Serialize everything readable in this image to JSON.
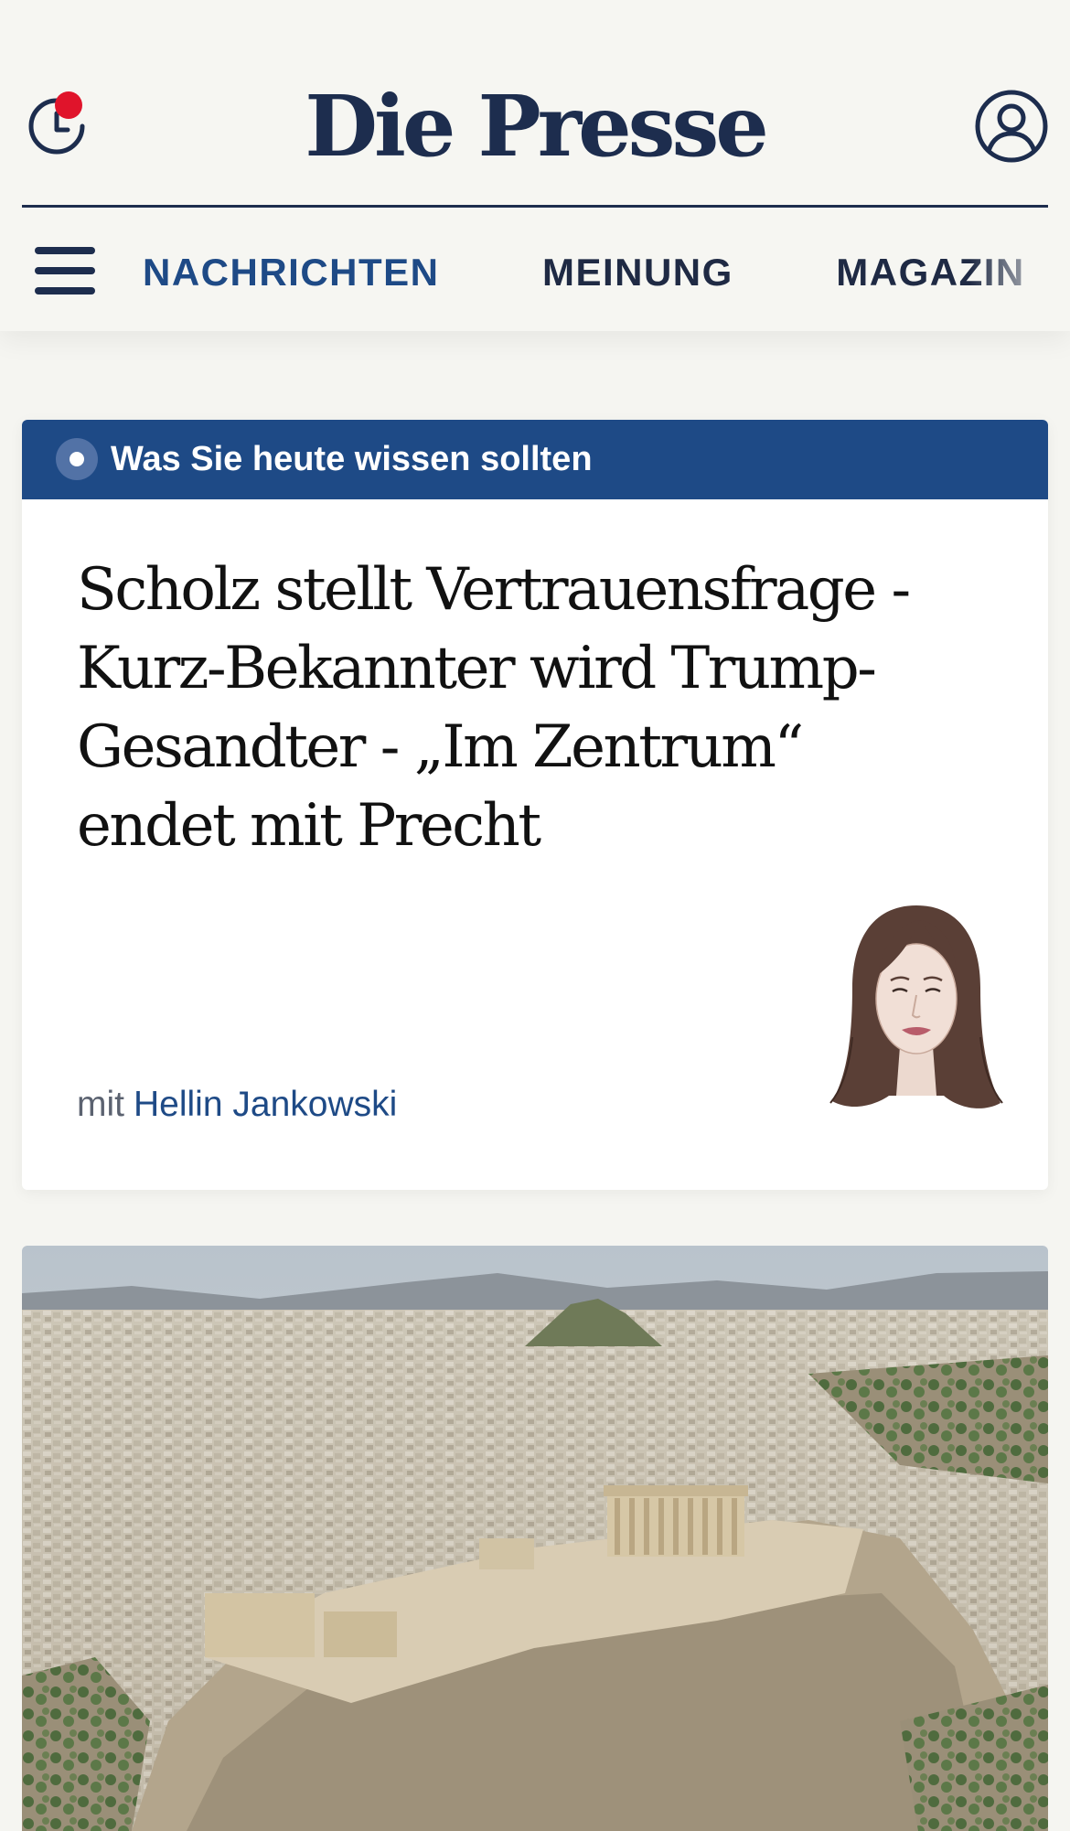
{
  "header": {
    "logo": "Die Presse",
    "history_icon": "clock-history-icon",
    "notification_dot_color": "#e0142b",
    "account_icon": "user-account-icon"
  },
  "nav": {
    "menu_icon": "hamburger-menu-icon",
    "items": [
      {
        "label": "NACHRICHTEN",
        "active": true
      },
      {
        "label": "MEINUNG",
        "active": false
      },
      {
        "label": "MAGAZIN",
        "active": false
      }
    ]
  },
  "briefing": {
    "band_icon": "radio-dot-icon",
    "band_label": "Was Sie heute wissen sollten",
    "headline": "Scholz stellt Vertrauensfrage - Kurz-Bekannter wird Trump-Gesandter - „Im Zentrum“ endet mit Precht",
    "byline_prefix": "mit",
    "author": "Hellin Jankowski"
  },
  "colors": {
    "brand_navy": "#1d2d4e",
    "accent_blue": "#1e4a86",
    "background": "#f5f5f1"
  }
}
